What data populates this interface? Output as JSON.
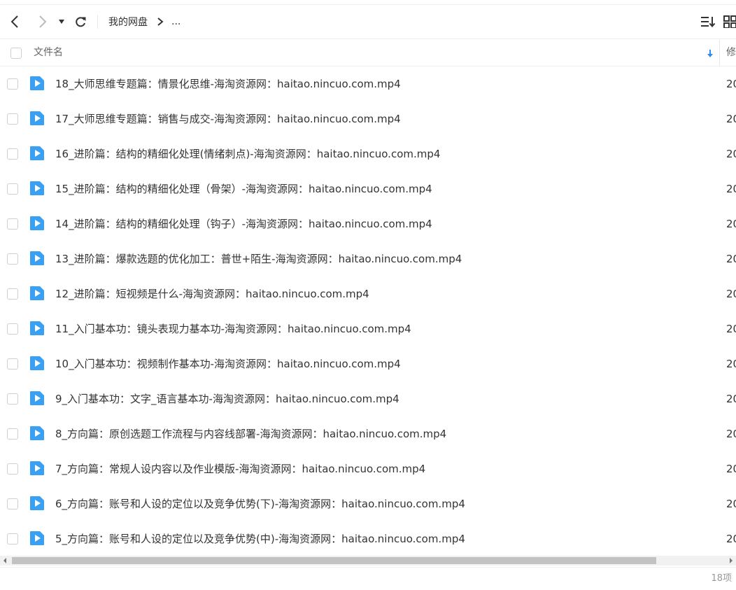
{
  "toolbar": {
    "back_icon": "chevron-left-icon",
    "forward_icon": "chevron-right-icon",
    "history_icon": "caret-down-icon",
    "refresh_icon": "refresh-icon",
    "breadcrumb": {
      "root": "我的网盘",
      "separator": ">",
      "more": "..."
    },
    "sort_view_icon": "sort-list-icon",
    "grid_view_icon": "grid-icon"
  },
  "header": {
    "name_label": "文件名",
    "sort_icon": "sort-desc-arrow-icon",
    "modified_label": "修"
  },
  "files": [
    {
      "name": "18_大师思维专题篇：情景化思维-海淘资源网：haitao.nincuo.com.mp4",
      "date": "20"
    },
    {
      "name": "17_大师思维专题篇：销售与成交-海淘资源网：haitao.nincuo.com.mp4",
      "date": "20"
    },
    {
      "name": "16_进阶篇：结构的精细化处理(情绪刺点)-海淘资源网：haitao.nincuo.com.mp4",
      "date": "20"
    },
    {
      "name": "15_进阶篇：结构的精细化处理（骨架）-海淘资源网：haitao.nincuo.com.mp4",
      "date": "20"
    },
    {
      "name": "14_进阶篇：结构的精细化处理（钩子）-海淘资源网：haitao.nincuo.com.mp4",
      "date": "20"
    },
    {
      "name": "13_进阶篇：爆款选题的优化加工：普世+陌生-海淘资源网：haitao.nincuo.com.mp4",
      "date": "20"
    },
    {
      "name": "12_进阶篇：短视频是什么-海淘资源网：haitao.nincuo.com.mp4",
      "date": "20"
    },
    {
      "name": "11_入门基本功：镜头表现力基本功-海淘资源网：haitao.nincuo.com.mp4",
      "date": "20"
    },
    {
      "name": "10_入门基本功：视频制作基本功-海淘资源网：haitao.nincuo.com.mp4",
      "date": "20"
    },
    {
      "name": "9_入门基本功：文字_语言基本功-海淘资源网：haitao.nincuo.com.mp4",
      "date": "20"
    },
    {
      "name": "8_方向篇：原创选题工作流程与内容线部署-海淘资源网：haitao.nincuo.com.mp4",
      "date": "20"
    },
    {
      "name": "7_方向篇：常规人设内容以及作业模版-海淘资源网：haitao.nincuo.com.mp4",
      "date": "20"
    },
    {
      "name": "6_方向篇：账号和人设的定位以及竞争优势(下)-海淘资源网：haitao.nincuo.com.mp4",
      "date": "20"
    },
    {
      "name": "5_方向篇：账号和人设的定位以及竞争优势(中)-海淘资源网：haitao.nincuo.com.mp4",
      "date": "20"
    }
  ],
  "file_icon": "video-file-icon",
  "status": {
    "item_count": "18项"
  },
  "colors": {
    "accent": "#2d8cf0",
    "file_icon": "#3aa0f3",
    "text": "#333333",
    "muted": "#999999"
  }
}
